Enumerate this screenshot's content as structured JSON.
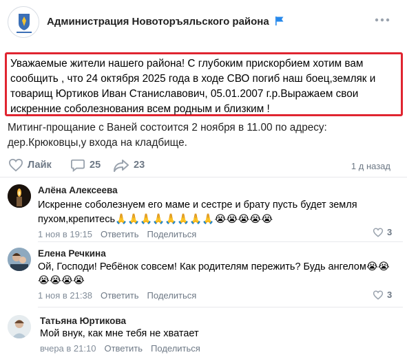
{
  "group": {
    "name": "Администрация Новоторъяльского района",
    "avatar_caption": "НОВОТОРЪЯЛЬСКИЙ МУНИЦИПАЛЬНЫЙ РАЙОН",
    "avatar_label": "ИЗАРСССКО"
  },
  "post": {
    "highlighted_lines": [
      "Уважаемые жители нашего района! С глубоким прискорбием хотим вам",
      "сообщить , что 24 октября 2025 года в ходе СВО погиб наш боец,земляк и",
      "товарищ Юртиков Иван Станиславович, 05.01.2007 г.р.Выражаем свои",
      "искренние соболезнования всем родным и близким !"
    ],
    "tail_lines": [
      "Митинг-прощание с Ваней состоится 2 ноября в 11.00 по адресу:",
      "дер.Крюковцы,у входа на кладбище."
    ],
    "like_label": "Лайк",
    "comments_count": "25",
    "shares_count": "23",
    "time_ago": "1 д назад"
  },
  "comments": [
    {
      "name": "Алёна Алексеева",
      "lines": [
        "Искренне соболезнуем его маме и сестре и брату пусть будет земля",
        "пухом,крепитесь🙏🙏🙏🙏🙏🙏🙏🙏😭😭😭😭😭"
      ],
      "time": "1 ноя в 19:15",
      "reply_label": "Ответить",
      "share_label": "Поделиться",
      "likes": "3"
    },
    {
      "name": "Елена Речкина",
      "lines": [
        "Ой, Господи! Ребёнок совсем! Как родителям пережить? Будь ангелом😭😭",
        "😭😭😭😭"
      ],
      "time": "1 ноя в 21:38",
      "reply_label": "Ответить",
      "share_label": "Поделиться",
      "likes": "3"
    },
    {
      "name": "Татьяна Юртикова",
      "lines": [
        "Мой внук, как мне тебя не хватает"
      ],
      "time": "вчера в 21:10",
      "reply_label": "Ответить",
      "share_label": "Поделиться",
      "likes": ""
    }
  ],
  "colors": {
    "accent": "#2688eb",
    "highlight_border": "#e02430",
    "muted": "#6d7885"
  }
}
